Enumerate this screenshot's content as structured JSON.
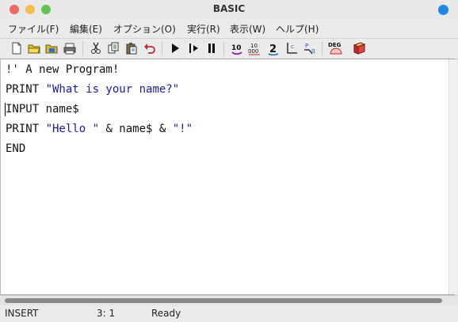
{
  "window": {
    "title": "BASIC"
  },
  "menu": [
    "ファイル(F)",
    "編集(E)",
    "オプション(O)",
    "実行(R)",
    "表示(W)",
    "ヘルプ(H)"
  ],
  "toolbar": {
    "icons": [
      "new-file-icon",
      "open-folder-icon",
      "open-folder-alt-icon",
      "print-icon",
      "cut-icon",
      "copy-icon",
      "paste-icon",
      "undo-icon",
      "run-icon",
      "step-icon",
      "pause-icon",
      "decimal-10-icon",
      "decimal-1000-icon",
      "numeric-2-icon",
      "axis-chart-icon",
      "axis-plot-icon",
      "deg-mode-icon",
      "help-book-icon"
    ],
    "deg_label": "DEG"
  },
  "editor": {
    "lines": [
      {
        "parts": [
          "!' A new Program!"
        ]
      },
      {
        "parts": [
          "PRINT ",
          "\"What is your name?\""
        ]
      },
      {
        "parts": [
          "INPUT name$"
        ]
      },
      {
        "parts": [
          "PRINT ",
          "\"Hello \"",
          " & name$ & ",
          "\"!\""
        ]
      },
      {
        "parts": [
          "END"
        ]
      }
    ]
  },
  "status": {
    "mode": "INSERT",
    "position": "3:  1",
    "state": "Ready"
  },
  "colors": {
    "accent": "#1e88e5",
    "string": "#1a1aa6"
  }
}
